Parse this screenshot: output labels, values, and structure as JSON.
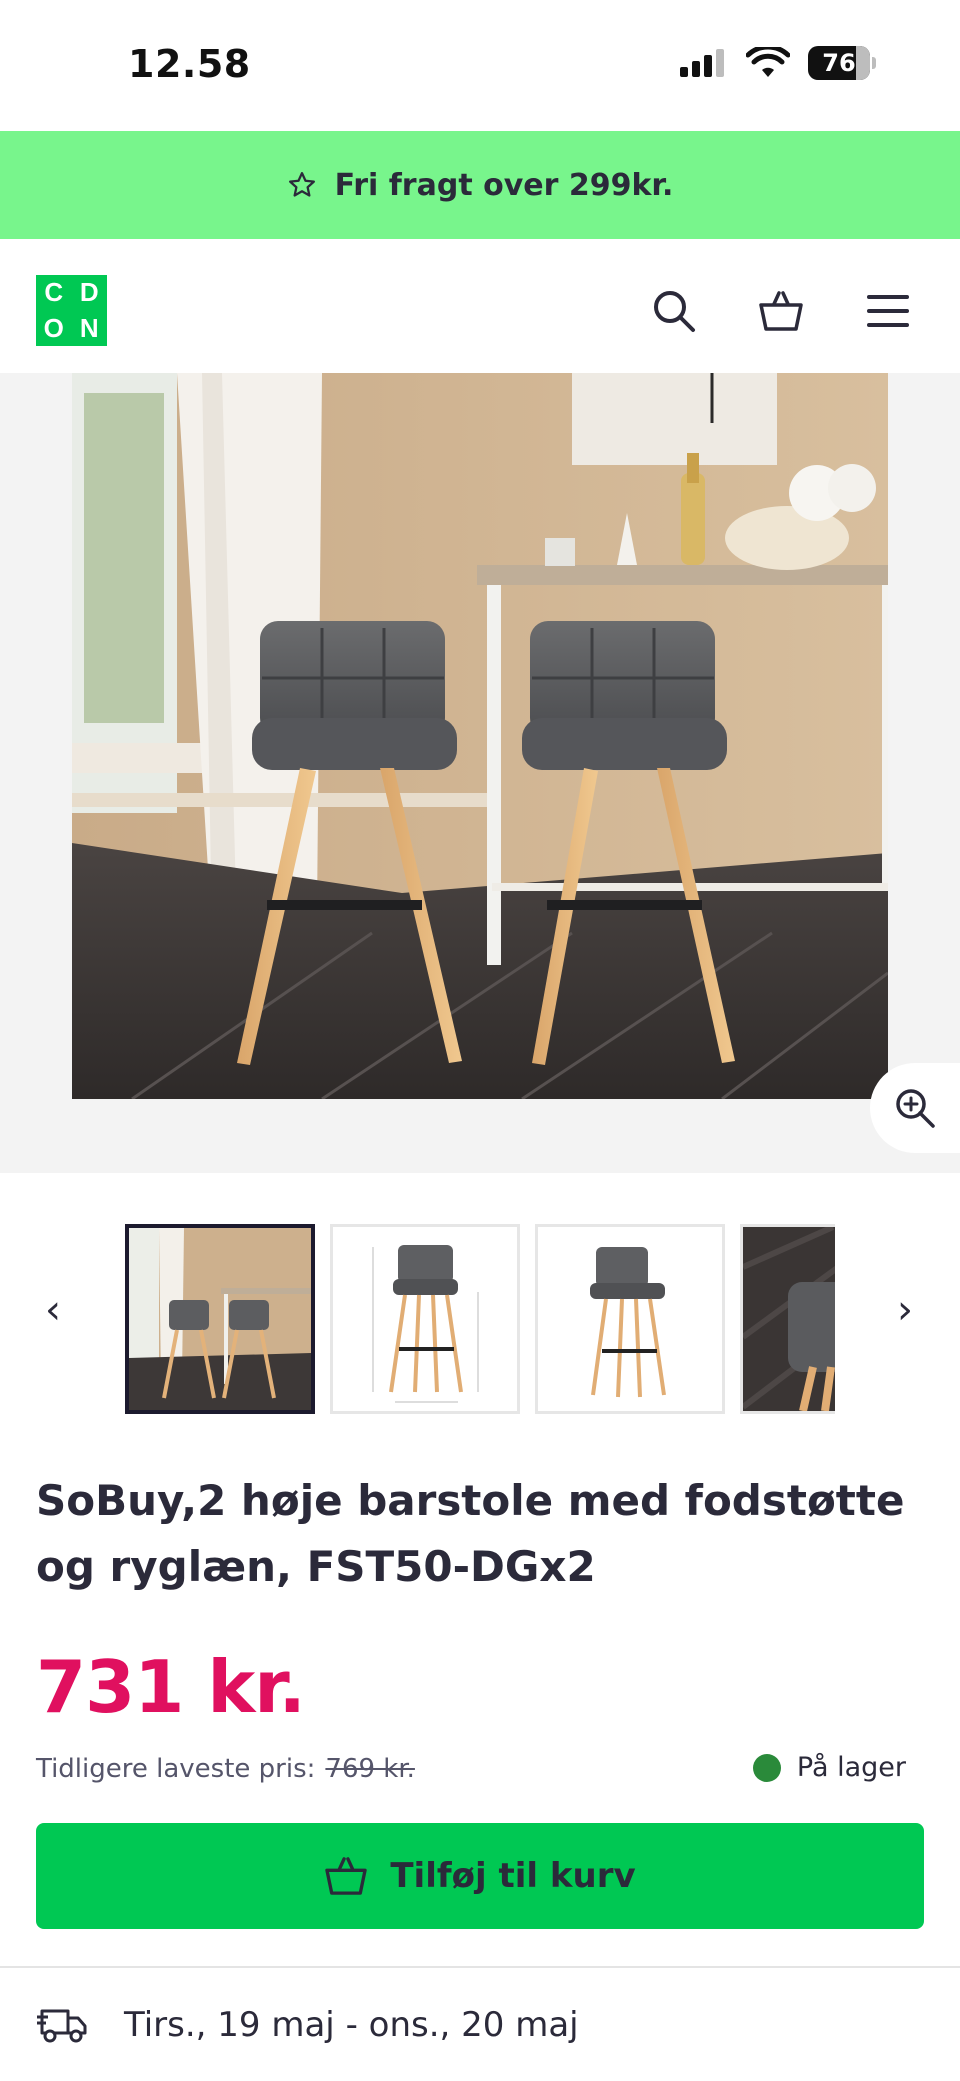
{
  "status_bar": {
    "time": "12.58",
    "battery": "76"
  },
  "promo": {
    "text": "Fri fragt over 299kr.",
    "icon": "star-outline-icon"
  },
  "header": {
    "logo_letters": [
      "C",
      "D",
      "O",
      "N"
    ],
    "icons": [
      "search-icon",
      "basket-icon",
      "menu-icon"
    ]
  },
  "gallery": {
    "zoom_icon": "zoom-in-icon",
    "prev_icon": "chevron-left-icon",
    "next_icon": "chevron-right-icon",
    "prev_glyph": "‹",
    "next_glyph": "›",
    "active_index": 0
  },
  "product": {
    "title": "SoBuy,2 høje barstole med fodstøtte og ryglæn, FST50-DGx2",
    "price": "731 kr.",
    "previous_price_label": "Tidligere laveste pris:",
    "previous_price": "769 kr.",
    "stock_status": "På lager",
    "add_to_cart": "Tilføj til kurv",
    "delivery": "Tirs., 19 maj - ons., 20 maj"
  },
  "colors": {
    "promo": "#78f58c",
    "brand": "#00c853",
    "price": "#e0105f",
    "in_stock": "#2a8a3a"
  }
}
